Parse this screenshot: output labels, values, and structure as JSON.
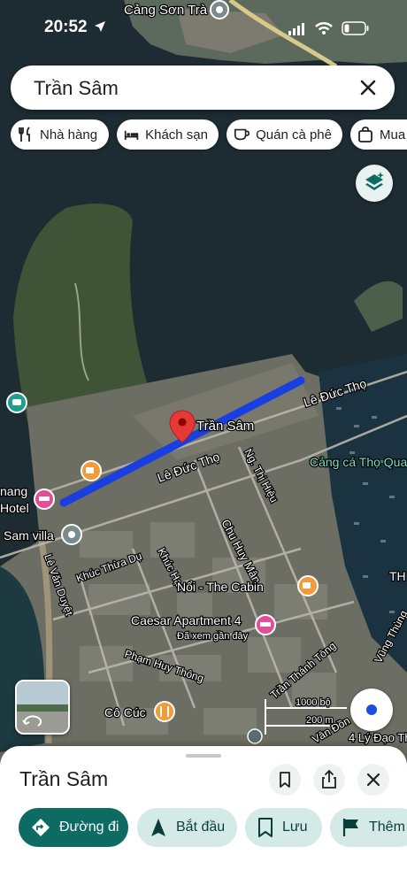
{
  "status_bar": {
    "time": "20:52"
  },
  "search": {
    "query": "Trần Sâm"
  },
  "chips": [
    {
      "label": "Nhà hàng",
      "icon": "fork-knife-icon"
    },
    {
      "label": "Khách sạn",
      "icon": "bed-icon"
    },
    {
      "label": "Quán cà phê",
      "icon": "coffee-cup-icon"
    },
    {
      "label": "Mua",
      "icon": "shopping-bag-icon"
    }
  ],
  "map_labels": {
    "port_top": "Cảng Sơn Trà",
    "selected_street": "Trần Sâm",
    "le_duc_tho_east": "Lê Đức Thọ",
    "le_duc_tho_west": "Lê Đức Thọ",
    "ng_thi_hieu": "Ng. Thị Hiệu",
    "fishing_port": "Cảng cá Thọ Quang",
    "chu_huy_man": "Chu Huy Mân",
    "hotel_partial": "nang\nHotel",
    "sam_villa": "Sam villa",
    "le_van_duyet": "Lê Văn Duyệt",
    "khuc_thua_du": "Khúc Thừa Dụ",
    "khuc_hao": "Khúc Hạo",
    "noi_cabin": "Nổi - The Cabin",
    "th_partial": "TH",
    "caesar": "Caesar Apartment 4",
    "caesar_sub": "Đã xem gần đây",
    "pham_huy_thong": "Phạm Huy Thông",
    "tran_thanh_tong": "Trần Thánh Tông",
    "vung_thung": "Vũng Thùng",
    "co_cuc": "Cô Cúc",
    "van_don": "Vân Đồn",
    "ly_dao_thanh": "4 Lý Đạo Th",
    "scale_ft": "1000 bộ",
    "scale_m": "200 m"
  },
  "place_sheet": {
    "title": "Trần Sâm",
    "actions": [
      {
        "label": "Đường đi",
        "icon": "directions-icon"
      },
      {
        "label": "Bắt đầu",
        "icon": "navigation-arrow-icon"
      },
      {
        "label": "Lưu",
        "icon": "bookmark-icon"
      },
      {
        "label": "Thêm",
        "icon": "flag-icon"
      }
    ]
  },
  "colors": {
    "route": "#1a3fe0",
    "pin": "#e53935",
    "water": "#1c2b31",
    "primary_button": "#0d6b63"
  }
}
